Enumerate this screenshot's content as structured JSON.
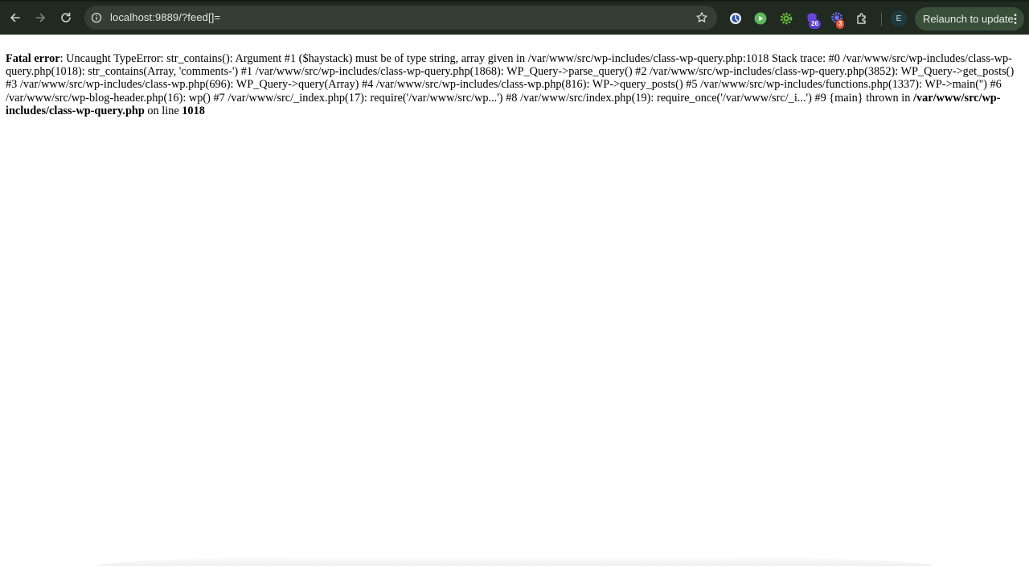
{
  "browser": {
    "url": "localhost:9889/?feed[]=",
    "relaunch_label": "Relaunch to update",
    "profile_initial": "E",
    "extensions": [
      {
        "name": "privacy-extension-icon",
        "badge": ""
      },
      {
        "name": "play-extension-icon",
        "badge": ""
      },
      {
        "name": "gear-extension-icon",
        "badge": ""
      },
      {
        "name": "shield-extension-icon",
        "badge": "26"
      },
      {
        "name": "bug-extension-icon",
        "badge": "3"
      },
      {
        "name": "puzzle-icon",
        "badge": ""
      }
    ],
    "colors": {
      "toolbar": "#202a20",
      "omnibox": "#343e34",
      "relaunch": "#3a4f3a",
      "badge_purple": "#5b3fd0",
      "badge_red": "#e2553b"
    }
  },
  "error": {
    "label": "Fatal error",
    "message": ": Uncaught TypeError: str_contains(): Argument #1 ($haystack) must be of type string, array given in /var/www/src/wp-includes/class-wp-query.php:1018 Stack trace: #0 /var/www/src/wp-includes/class-wp-query.php(1018): str_contains(Array, 'comments-') #1 /var/www/src/wp-includes/class-wp-query.php(1868): WP_Query->parse_query() #2 /var/www/src/wp-includes/class-wp-query.php(3852): WP_Query->get_posts() #3 /var/www/src/wp-includes/class-wp.php(696): WP_Query->query(Array) #4 /var/www/src/wp-includes/class-wp.php(816): WP->query_posts() #5 /var/www/src/wp-includes/functions.php(1337): WP->main('') #6 /var/www/src/wp-blog-header.php(16): wp() #7 /var/www/src/_index.php(17): require('/var/www/src/wp...') #8 /var/www/src/index.php(19): require_once('/var/www/src/_i...') #9 {main} thrown in ",
    "file": "/var/www/src/wp-includes/class-wp-query.php",
    "on_line_text": " on line ",
    "line": "1018"
  }
}
